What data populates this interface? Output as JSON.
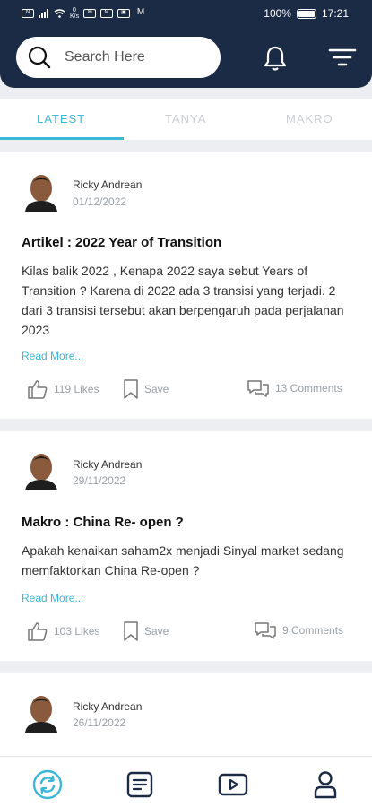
{
  "status_bar": {
    "left_icons": [
      "nfc-icon",
      "signal-icon",
      "wifi-icon",
      "speed-icon",
      "mail-icon",
      "message-icon",
      "image-icon",
      "gmail-icon"
    ],
    "speed": "0\nK/s",
    "battery": "100%",
    "time": "17:21"
  },
  "header": {
    "search_placeholder": "Search Here",
    "bell_icon": "bell-icon",
    "filter_icon": "filter-icon",
    "bg_color": "#1b2b45"
  },
  "tabs": [
    {
      "label": "LATEST",
      "active": true
    },
    {
      "label": "TANYA",
      "active": false
    },
    {
      "label": "MAKRO",
      "active": false
    }
  ],
  "accent_color": "#3db7d8",
  "posts": [
    {
      "author": "Ricky Andrean",
      "date": "01/12/2022",
      "title": "Artikel : 2022 Year of Transition",
      "body": "Kilas balik 2022 , Kenapa 2022 saya sebut  Years of Transition ? Karena di 2022 ada 3 transisi yang terjadi. 2 dari 3 transisi tersebut akan berpengaruh pada perjalanan 2023",
      "read_more": "Read More...",
      "likes": "119 Likes",
      "save": "Save",
      "comments": "13 Comments"
    },
    {
      "author": "Ricky Andrean",
      "date": "29/11/2022",
      "title": "Makro :  China Re- open ?",
      "body": "Apakah kenaikan saham2x menjadi Sinyal market sedang memfaktorkan China Re-open ?",
      "read_more": "Read More...",
      "likes": "103 Likes",
      "save": "Save",
      "comments": "9 Comments"
    },
    {
      "author": "Ricky Andrean",
      "date": "26/11/2022"
    }
  ],
  "bottom_nav": [
    "refresh-icon",
    "article-icon",
    "video-icon",
    "profile-icon"
  ]
}
